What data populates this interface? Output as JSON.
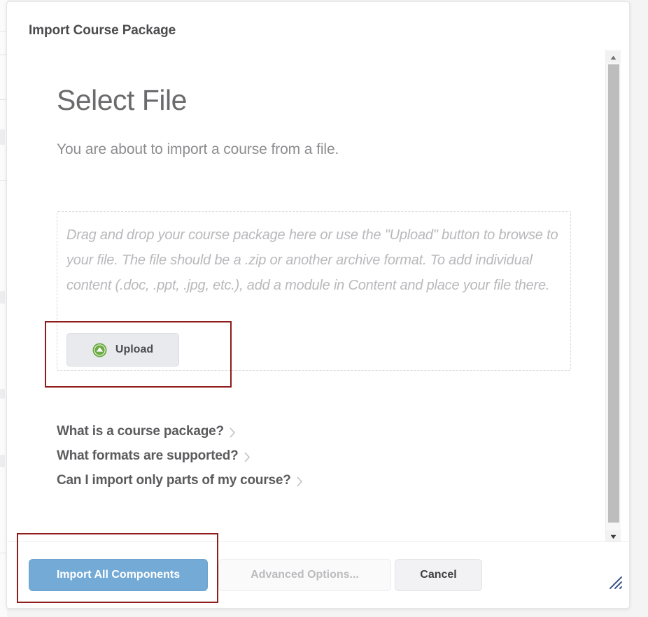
{
  "dialog": {
    "title": "Import Course Package"
  },
  "main": {
    "heading": "Select File",
    "subheading": "You are about to import a course from a file.",
    "dropzone": {
      "instructions": "Drag and drop your course package here or use the \"Upload\" button to browse to your file. The file should be a .zip or another archive format. To add individual content (.doc, .ppt, .jpg, etc.), add a module in Content and place your file there.",
      "upload_label": "Upload",
      "upload_icon": "upload-circle-icon"
    },
    "faq": [
      {
        "label": "What is a course package?",
        "icon": "chevron-right-icon"
      },
      {
        "label": "What formats are supported?",
        "icon": "chevron-right-icon"
      },
      {
        "label": "Can I import only parts of my course?",
        "icon": "chevron-right-icon"
      }
    ]
  },
  "footer": {
    "import_label": "Import All Components",
    "advanced_label": "Advanced Options...",
    "cancel_label": "Cancel"
  },
  "scrollbar": {
    "up_icon": "triangle-up-icon",
    "down_icon": "triangle-down-icon",
    "thumb": "scrollbar-thumb"
  },
  "resize": {
    "icon": "resize-grip-icon"
  },
  "colors": {
    "primary_button": "#74aad6",
    "upload_icon_green": "#6cab44",
    "annotation_red": "#8f1d1d",
    "heading_gray": "#6b6b6e"
  }
}
